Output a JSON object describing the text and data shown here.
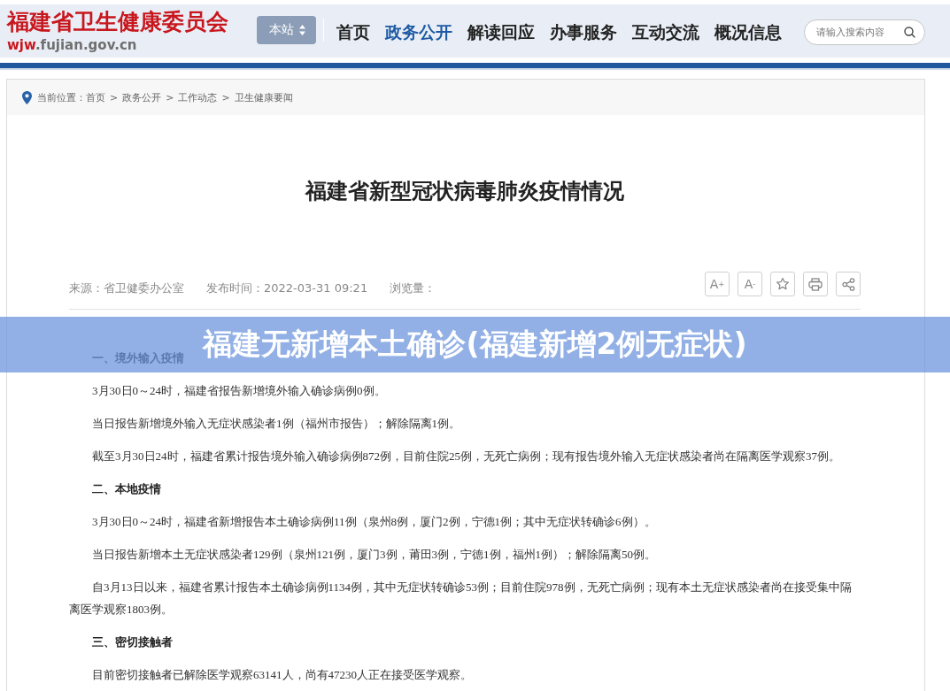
{
  "header": {
    "logo": {
      "title": "福建省卫生健康委员会",
      "domain": [
        "wjw",
        ".fujian.gov.cn"
      ]
    },
    "scope_select": {
      "value": "本站"
    },
    "nav": [
      {
        "label": "首页",
        "selected": false
      },
      {
        "label": "政务公开",
        "selected": true
      },
      {
        "label": "解读回应",
        "selected": false
      },
      {
        "label": "办事服务",
        "selected": false
      },
      {
        "label": "互动交流",
        "selected": false
      },
      {
        "label": "概况信息",
        "selected": false
      }
    ],
    "search": {
      "placeholder": "请输入搜索内容"
    }
  },
  "breadcrumb": {
    "label": "当前位置：",
    "items": [
      {
        "label": "首页"
      },
      {
        "label": "政务公开",
        "separator": ">"
      },
      {
        "label": "工作动态",
        "separator": ">"
      },
      {
        "label": "卫生健康要闻",
        "separator": ">"
      }
    ]
  },
  "article": {
    "title": "福建省新型冠状病毒肺炎疫情情况",
    "meta": [
      "来源：省卫健委办公室",
      "发布时间：2022-03-31 09:21",
      "浏览量："
    ],
    "tools": [
      {
        "kind": "text",
        "label": "A$^{+}$"
      },
      {
        "kind": "text",
        "label": "A$^{-}$"
      },
      {
        "kind": "star"
      },
      {
        "kind": "print"
      },
      {
        "kind": "share"
      }
    ],
    "body": [
      {
        "kind": "heading",
        "text": "一、境外输入疫情"
      },
      {
        "kind": "paragraph",
        "text": "3月30日0～24时，福建省报告新增境外输入确诊病例0例。"
      },
      {
        "kind": "paragraph",
        "text": "当日报告新增境外输入无症状感染者1例（福州市报告）；解除隔离1例。"
      },
      {
        "kind": "paragraph",
        "text": "截至3月30日24时，福建省累计报告境外输入确诊病例872例，目前住院25例，无死亡病例；现有报告境外输入无症状感染者尚在隔离医学观察37例。"
      },
      {
        "kind": "heading",
        "text": "二、本地疫情"
      },
      {
        "kind": "paragraph",
        "text": "3月30日0～24时，福建省新增报告本土确诊病例11例（泉州8例，厦门2例，宁德1例；其中无症状转确诊6例）。"
      },
      {
        "kind": "paragraph",
        "text": "当日报告新增本土无症状感染者129例（泉州121例，厦门3例，莆田3例，宁德1例，福州1例）；解除隔离50例。"
      },
      {
        "kind": "paragraph",
        "text": "自3月13日以来，福建省累计报告本土确诊病例1134例，其中无症状转确诊53例；目前住院978例，无死亡病例；现有本土无症状感染者尚在接受集中隔离医学观察1803例。"
      },
      {
        "kind": "heading",
        "text": "三、密切接触者"
      },
      {
        "kind": "paragraph",
        "text": "目前密切接触者已解除医学观察63141人，尚有47230人正在接受医学观察。"
      }
    ]
  },
  "banner": {
    "text": "福建无新增本土确诊(福建新增2例无症状)"
  }
}
